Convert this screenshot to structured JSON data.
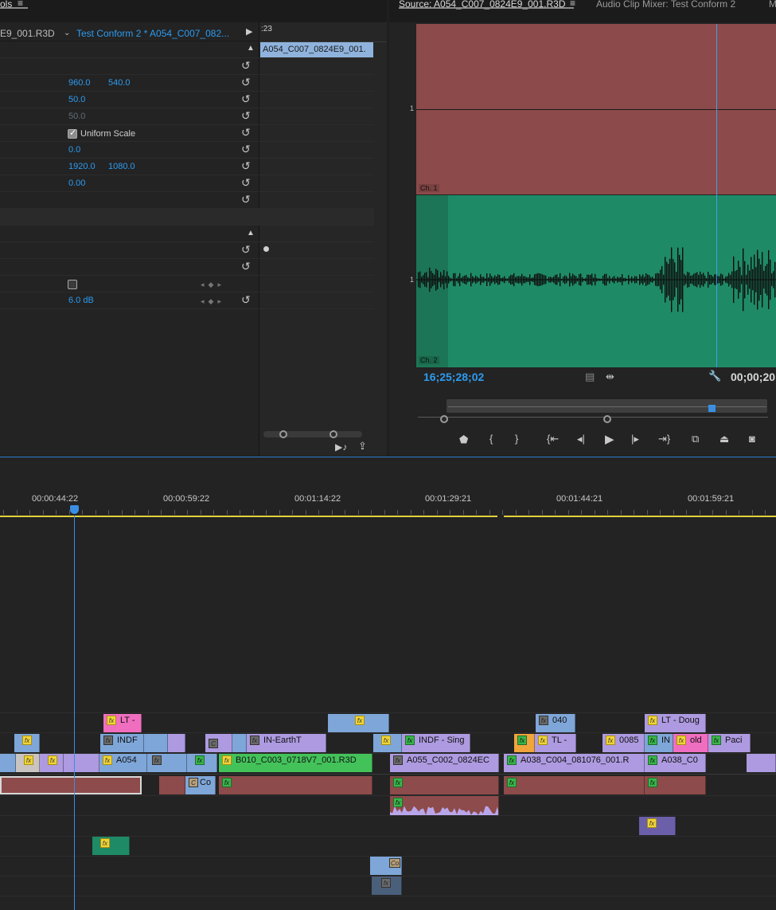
{
  "effect_controls": {
    "tab_label": "ols",
    "source_clip": "E9_001.R3D",
    "sequence_clip": "Test Conform 2 * A054_C007_082...",
    "timecode_hint": ":23",
    "mini_clip_label": "A054_C007_0824E9_001.",
    "position_x": "960.0",
    "position_y": "540.0",
    "scale": "50.0",
    "scale_width": "50.0",
    "uniform_scale_label": "Uniform Scale",
    "rotation": "0.0",
    "anchor_x": "1920.0",
    "anchor_y": "1080.0",
    "anti_flicker": "0.00",
    "audio_level": "6.0 dB"
  },
  "source_monitor": {
    "tab_label": "Source: A054_C007_0824E9_001.R3D",
    "mixer_tab_label": "Audio Clip Mixer: Test Conform 2",
    "extra_tab_label": "M",
    "ch1_label": "Ch. 1",
    "ch2_label": "Ch. 2",
    "scale_marker": "1",
    "timecode_in": "16;25;28;02",
    "timecode_duration": "00;00;20"
  },
  "timeline": {
    "ruler": [
      "00:00:44:22",
      "00:00:59:22",
      "00:01:14:22",
      "00:01:29:21",
      "00:01:44:21",
      "00:01:59:21"
    ],
    "clips": {
      "lt_upper": "LT -",
      "c_040": "040",
      "lt_doug": "LT - Doug",
      "indf_v2": "INDF",
      "in_earth": "IN-EarthT",
      "indf_sing": "INDF - Sing",
      "tl_clip": "TL -",
      "c_0085": "0085",
      "in_short": "IN",
      "old_clip": "old",
      "paci": "Paci",
      "a054": "A054",
      "b010": "B010_C003_0718V7_001.R3D",
      "a055": "A055_C002_0824EC",
      "a038_long": "A038_C004_081076_001.R",
      "a038_short": "A038_C0",
      "c_short": "C",
      "co_clip": "Co",
      "co_small": "Co"
    }
  }
}
